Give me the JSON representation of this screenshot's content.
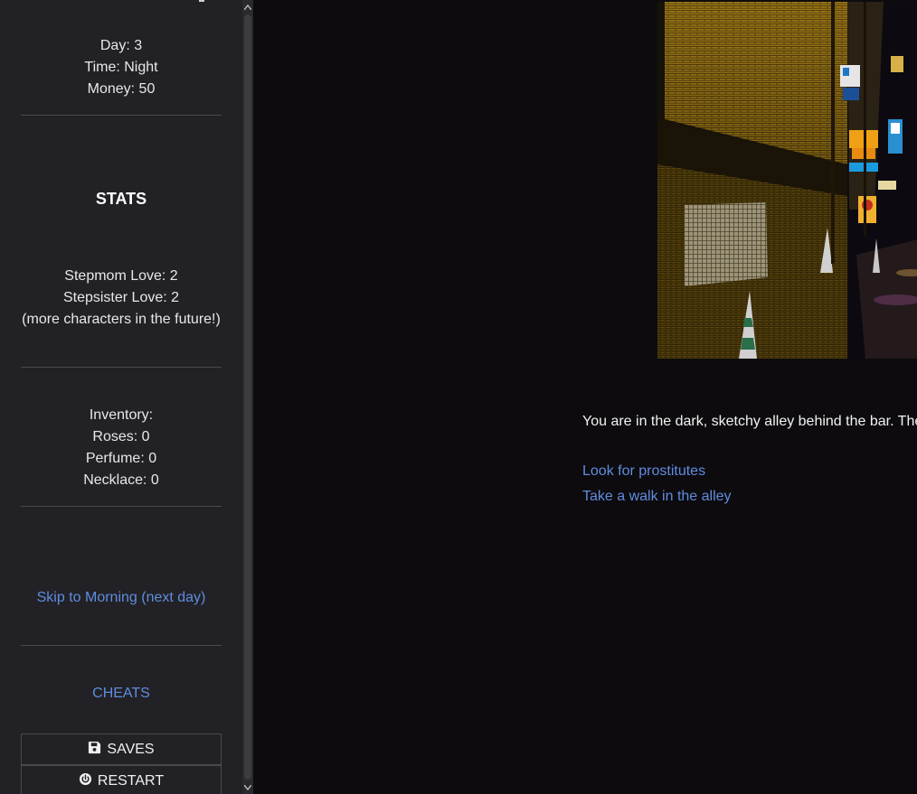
{
  "status": {
    "day": "Day: 3",
    "time": "Time: Night",
    "money": "Money: 50"
  },
  "stats": {
    "title": "STATS",
    "lines": [
      "Stepmom Love: 2",
      "Stepsister Love: 2",
      "(more characters in the future!)"
    ]
  },
  "inventory": {
    "title": "Inventory:",
    "items": [
      "Roses: 0",
      "Perfume: 0",
      "Necklace: 0"
    ]
  },
  "links": {
    "skip": "Skip to Morning (next day)",
    "cheats": "CHEATS"
  },
  "buttons": {
    "saves": "SAVES",
    "restart": "RESTART"
  },
  "main": {
    "passage": "You are in the dark, sketchy alley behind the bar. The",
    "choices": [
      "Look for prostitutes",
      "Take a walk in the alley"
    ]
  },
  "colors": {
    "sidebar_bg": "#222125",
    "main_bg": "#0d0b0e",
    "link": "#5f8de0"
  },
  "icons": {
    "saves": "floppy-disk-icon",
    "restart": "power-icon"
  }
}
